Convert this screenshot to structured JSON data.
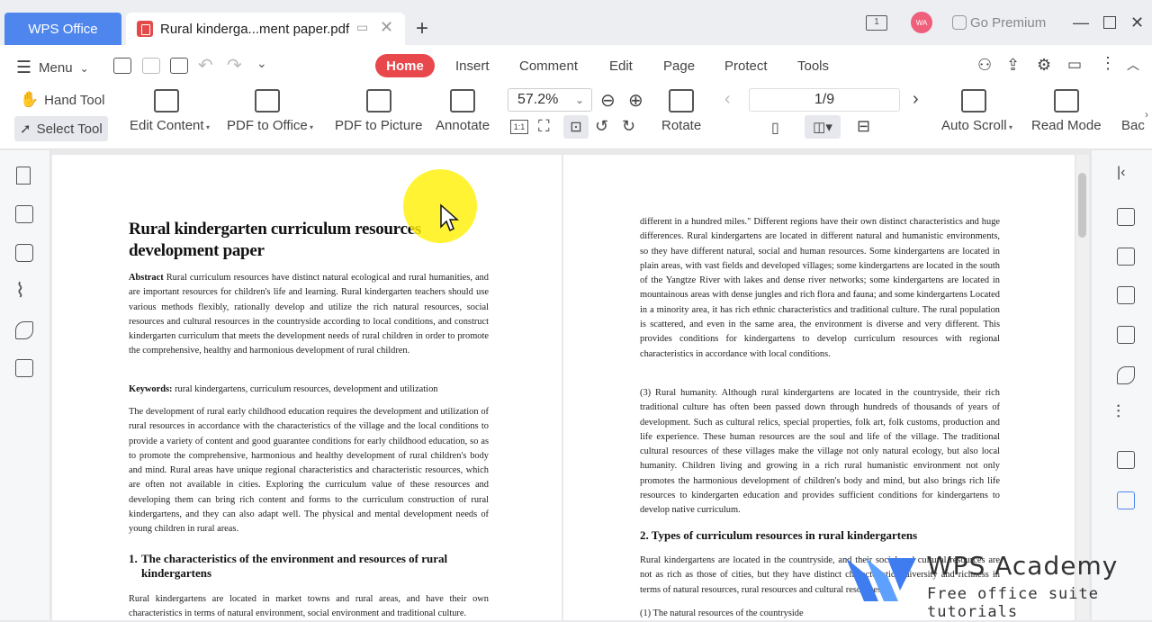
{
  "tabs": {
    "wps_tab": "WPS Office",
    "doc_tab": "Rural kinderga...ment paper.pdf"
  },
  "window": {
    "avatar_initials": "WA",
    "premium_label": "Go Premium"
  },
  "menu": {
    "menu_label": "Menu",
    "items": [
      "Home",
      "Insert",
      "Comment",
      "Edit",
      "Page",
      "Protect",
      "Tools"
    ]
  },
  "tools": {
    "hand_tool": "Hand Tool",
    "select_tool": "Select Tool",
    "edit_content": "Edit Content",
    "pdf_to_office": "PDF to Office",
    "pdf_to_picture": "PDF to Picture",
    "annotate": "Annotate",
    "zoom_value": "57.2%",
    "rotate": "Rotate",
    "page_indicator": "1/9",
    "auto_scroll": "Auto Scroll",
    "read_mode": "Read Mode",
    "background_partial": "Bac"
  },
  "document": {
    "title": "Rural kindergarten curriculum resources development paper",
    "abstract_label": "Abstract",
    "abstract_text": " Rural curriculum resources have distinct natural ecological and rural humanities, and are important resources for children's life and learning. Rural kindergarten teachers should use various methods flexibly, rationally develop and utilize the rich natural resources, social resources and cultural resources in the countryside according to local conditions, and construct kindergarten curriculum that meets the development needs of rural children in order to promote the comprehensive, healthy and harmonious development of rural children.",
    "keywords_label": "Keywords:",
    "keywords_text": " rural kindergartens, curriculum resources, development and utilization",
    "intro_text": "The development of rural early childhood education requires the development and utilization of rural resources in accordance with the characteristics of the village and the local conditions to provide a variety of content and good guarantee conditions for early childhood education, so as to promote the comprehensive, harmonious and healthy development of rural children's body and mind. Rural areas have unique regional characteristics and characteristic resources, which are often not available in cities. Exploring the curriculum value of these resources and developing them can bring rich content and forms to the curriculum construction of rural kindergartens, and they can also adapt well. The physical and mental development needs of young children in rural areas.",
    "section1_num": "1.",
    "section1_title": "The characteristics of the environment and resources of rural kindergartens",
    "section1_text": "Rural kindergartens are located in market towns and rural areas, and have their own characteristics in terms of natural environment, social environment and traditional culture.",
    "right_para1": "different in a hundred miles.\" Different regions have their own distinct characteristics and huge differences. Rural kindergartens are located in different natural and humanistic environments, so they have different natural, social and human resources. Some kindergartens are located in plain areas, with vast fields and developed villages; some kindergartens are located in the south of the Yangtze River with lakes and dense river networks; some kindergartens are located in mountainous areas with dense jungles and rich flora and fauna; and some kindergartens Located in a minority area, it has rich ethnic characteristics and traditional culture. The rural population is scattered, and even in the same area, the environment is diverse and very different. This provides conditions for kindergartens to develop curriculum resources with regional characteristics in accordance with local conditions.",
    "right_para2": "(3) Rural humanity. Although rural kindergartens are located in the countryside, their rich traditional culture has often been passed down through hundreds of thousands of years of development. Such as cultural relics, special properties, folk art, folk customs, production and life experience. These human resources are the soul and life of the village. The traditional cultural resources of these villages make the village not only natural ecology, but also local humanity. Children living and growing in a rich rural humanistic environment not only promotes the harmonious development of children's body and mind, but also brings rich life resources to kindergarten education and provides sufficient conditions for kindergartens to develop native curriculum.",
    "section2_title": "2. Types of curriculum resources in rural kindergartens",
    "right_para3": "Rural kindergartens are located in the countryside, and their social and cultural resources are not as rich as those of cities, but they have distinct characteristics, diversity and richness in terms of natural resources, rural resources and cultural resources.",
    "right_para4": "(1) The natural resources of the countryside"
  },
  "watermark": {
    "title": "WPS Academy",
    "subtitle": "Free office suite tutorials"
  },
  "colors": {
    "accent": "#4f86ed",
    "home_pill": "#e8474c"
  }
}
